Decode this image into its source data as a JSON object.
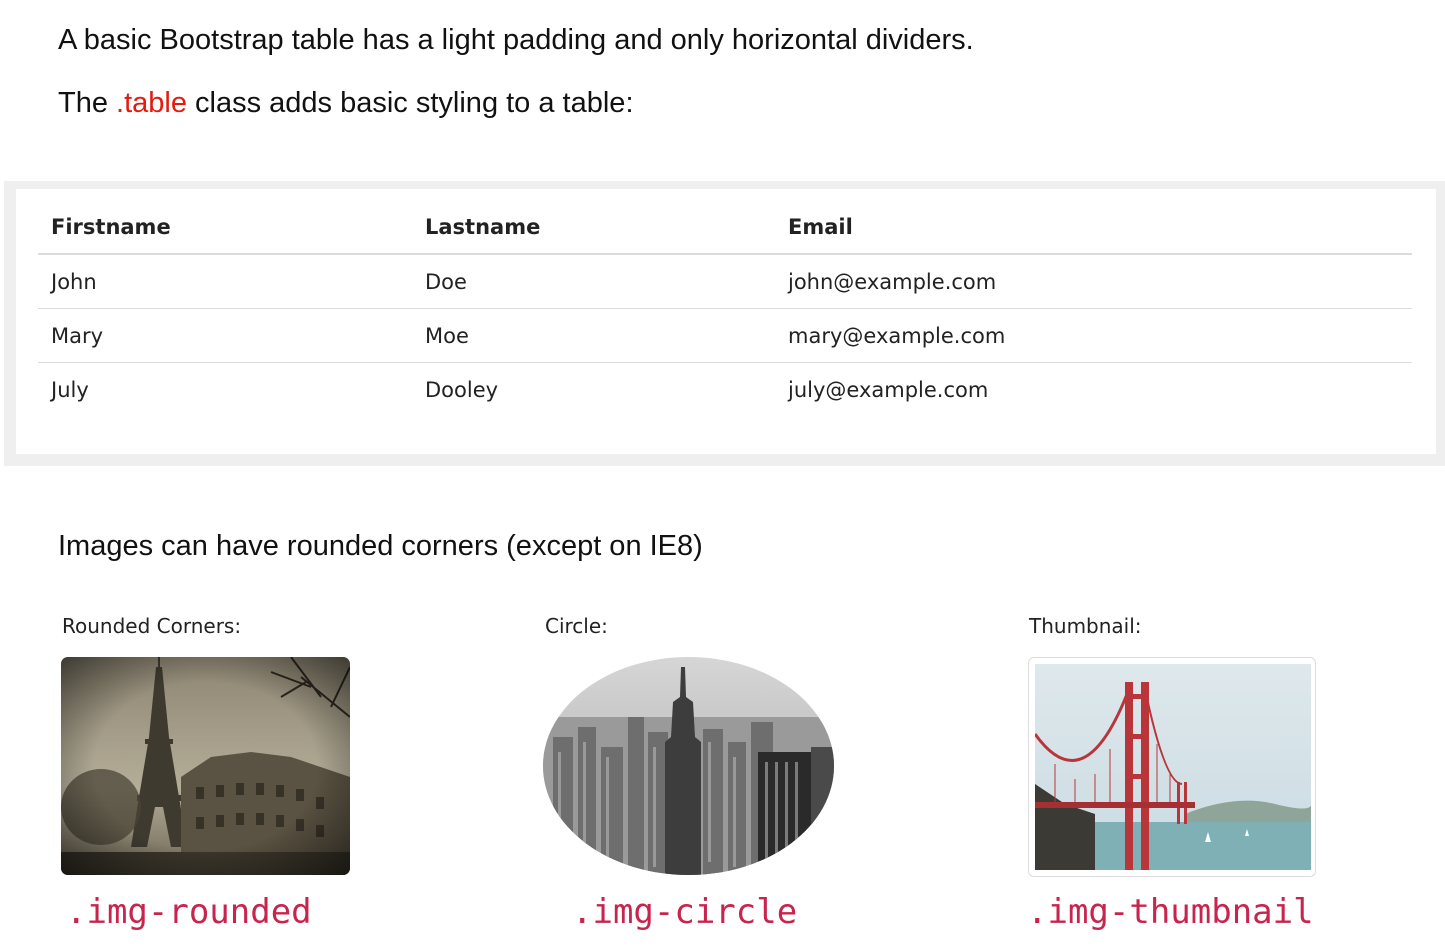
{
  "intro": {
    "line1": "A basic Bootstrap table has a light padding and only horizontal dividers.",
    "line2_before": "The ",
    "line2_class": ".table",
    "line2_after": " class adds basic styling to a table:"
  },
  "table": {
    "headers": [
      "Firstname",
      "Lastname",
      "Email"
    ],
    "rows": [
      [
        "John",
        "Doe",
        "john@example.com"
      ],
      [
        "Mary",
        "Moe",
        "mary@example.com"
      ],
      [
        "July",
        "Dooley",
        "july@example.com"
      ]
    ]
  },
  "images_section": {
    "title": "Images can have rounded corners (except on IE8)",
    "items": [
      {
        "label": "Rounded Corners:",
        "class_name": ".img-rounded",
        "subject": "Eiffel Tower and Paris buildings"
      },
      {
        "label": "Circle:",
        "class_name": ".img-circle",
        "subject": "New York skyline, black and white"
      },
      {
        "label": "Thumbnail:",
        "class_name": ".img-thumbnail",
        "subject": "Golden Gate Bridge"
      }
    ]
  },
  "colors": {
    "highlight_red": "#e31b0e",
    "code_color": "#c7254e",
    "divider": "#dcdcdc",
    "frame": "#efefef"
  }
}
